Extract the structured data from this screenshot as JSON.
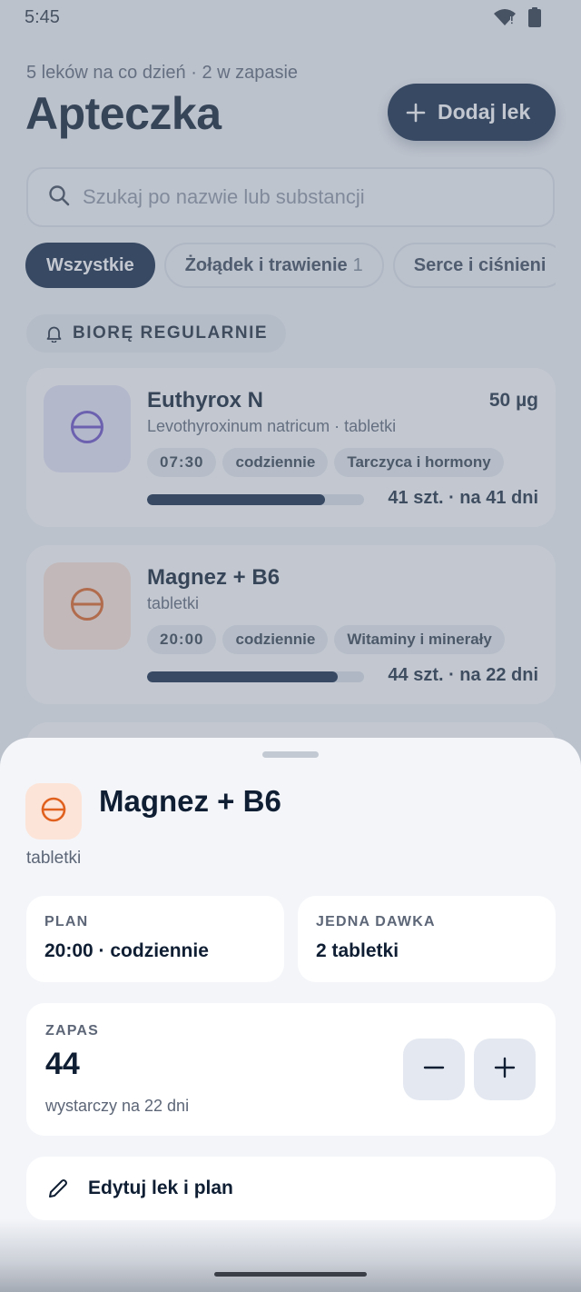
{
  "status_bar": {
    "time": "5:45"
  },
  "header": {
    "subtitle": "5 leków na co dzień · 2 w zapasie",
    "title": "Apteczka",
    "add_button": "Dodaj lek"
  },
  "search": {
    "placeholder": "Szukaj po nazwie lub substancji",
    "value": ""
  },
  "filters": [
    {
      "label": "Wszystkie",
      "count": "",
      "active": true
    },
    {
      "label": "Żołądek i trawienie",
      "count": "1",
      "active": false
    },
    {
      "label": "Serce i ciśnieni",
      "count": "",
      "active": false
    }
  ],
  "section_label": "BIORĘ REGULARNIE",
  "medications": [
    {
      "name": "Euthyrox N",
      "dose": "50 µg",
      "description": "Levothyroxinum natricum · tabletki",
      "time": "07:30",
      "frequency": "codziennie",
      "category": "Tarczyca i hormony",
      "stock": "41 szt. · na 41 dni",
      "stock_fraction": 0.82,
      "icon_color": "#6a4fc6",
      "thumb_bg": "#e6e3f7"
    },
    {
      "name": "Magnez + B6",
      "dose": "",
      "description": "tabletki",
      "time": "20:00",
      "frequency": "codziennie",
      "category": "Witaminy i minerały",
      "stock": "44 szt. · na 22 dni",
      "stock_fraction": 0.88,
      "icon_color": "#e0601e",
      "thumb_bg": "#fde4d8"
    }
  ],
  "sheet": {
    "name": "Magnez + B6",
    "description": "tabletki",
    "icon_color": "#e0601e",
    "plan_label": "PLAN",
    "plan_value": "20:00 · codziennie",
    "dose_label": "JEDNA DAWKA",
    "dose_value": "2 tabletki",
    "stock_label": "ZAPAS",
    "stock_value": "44",
    "stock_hint": "wystarczy na 22 dni",
    "edit_button": "Edytuj lek i plan"
  },
  "icons": {
    "search": "search-icon",
    "add": "plus-icon",
    "bell": "bell-icon",
    "pill": "pill-icon",
    "minus": "minus-icon",
    "plus": "plus-icon",
    "edit": "pencil-icon",
    "wifi": "wifi-icon",
    "battery": "battery-icon"
  }
}
